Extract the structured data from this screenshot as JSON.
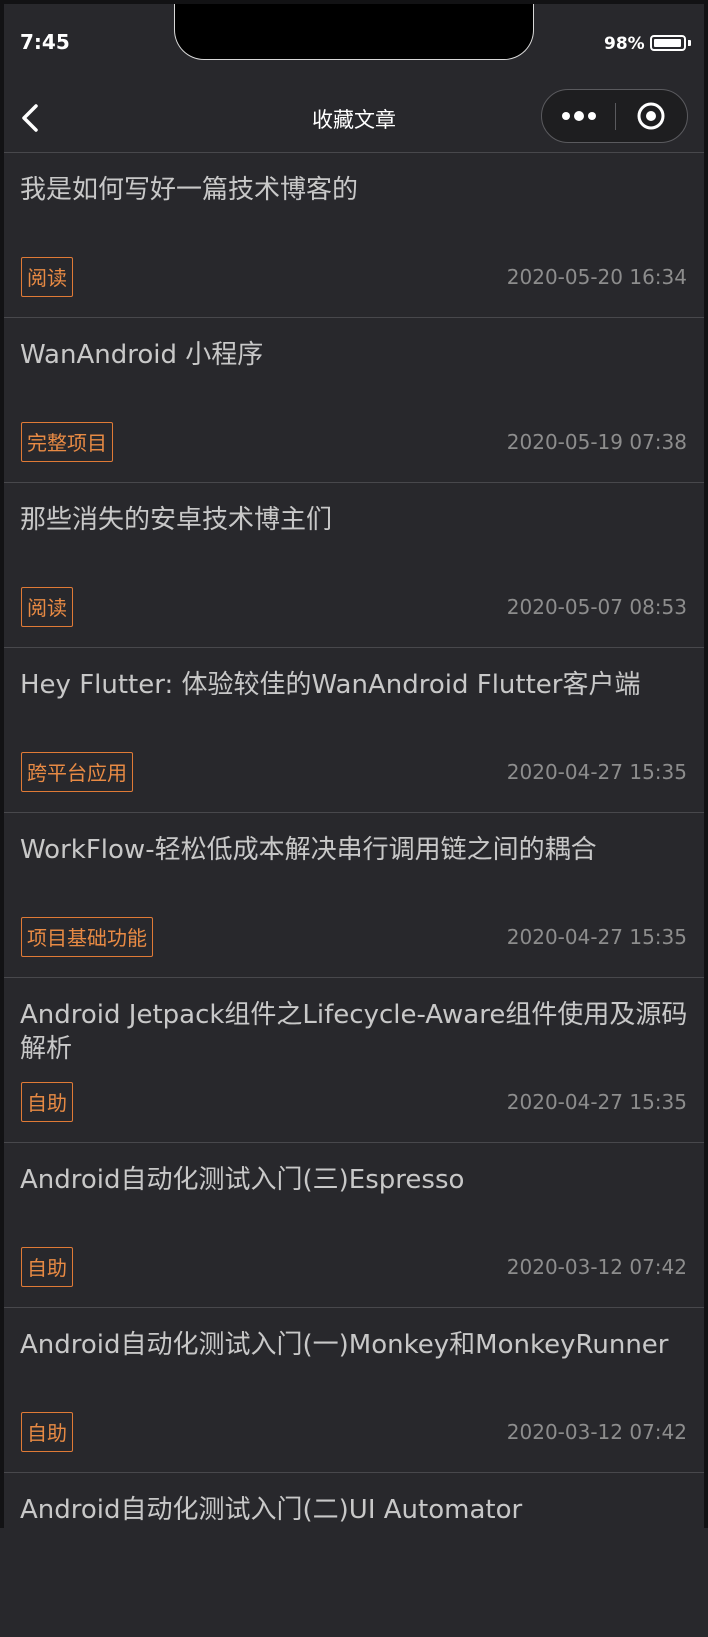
{
  "status_bar": {
    "time": "7:45",
    "battery_percent": "98%",
    "battery_level": 0.98
  },
  "nav": {
    "title": "收藏文章",
    "back_icon": "chevron-left-icon",
    "more_icon": "more-dots-icon",
    "close_icon": "target-circle-icon"
  },
  "colors": {
    "background": "#28282c",
    "tag_accent": "#e07a36",
    "divider": "#48484c"
  },
  "articles": [
    {
      "title": "我是如何写好一篇技术博客的",
      "tag": "阅读",
      "date": "2020-05-20 16:34"
    },
    {
      "title": "WanAndroid 小程序",
      "tag": "完整项目",
      "date": "2020-05-19 07:38"
    },
    {
      "title": "那些消失的安卓技术博主们",
      "tag": "阅读",
      "date": "2020-05-07 08:53"
    },
    {
      "title": "Hey Flutter: 体验较佳的WanAndroid Flutter客户端",
      "tag": "跨平台应用",
      "date": "2020-04-27 15:35"
    },
    {
      "title": "WorkFlow-轻松低成本解决串行调用链之间的耦合",
      "tag": "项目基础功能",
      "date": "2020-04-27 15:35"
    },
    {
      "title": "Android Jetpack组件之Lifecycle-Aware组件使用及源码解析",
      "tag": "自助",
      "date": "2020-04-27 15:35"
    },
    {
      "title": "Android自动化测试入门(三)Espresso",
      "tag": "自助",
      "date": "2020-03-12 07:42"
    },
    {
      "title": "Android自动化测试入门(一)Monkey和MonkeyRunner",
      "tag": "自助",
      "date": "2020-03-12 07:42"
    },
    {
      "title": "Android自动化测试入门(二)UI Automator",
      "tag": "",
      "date": ""
    }
  ]
}
